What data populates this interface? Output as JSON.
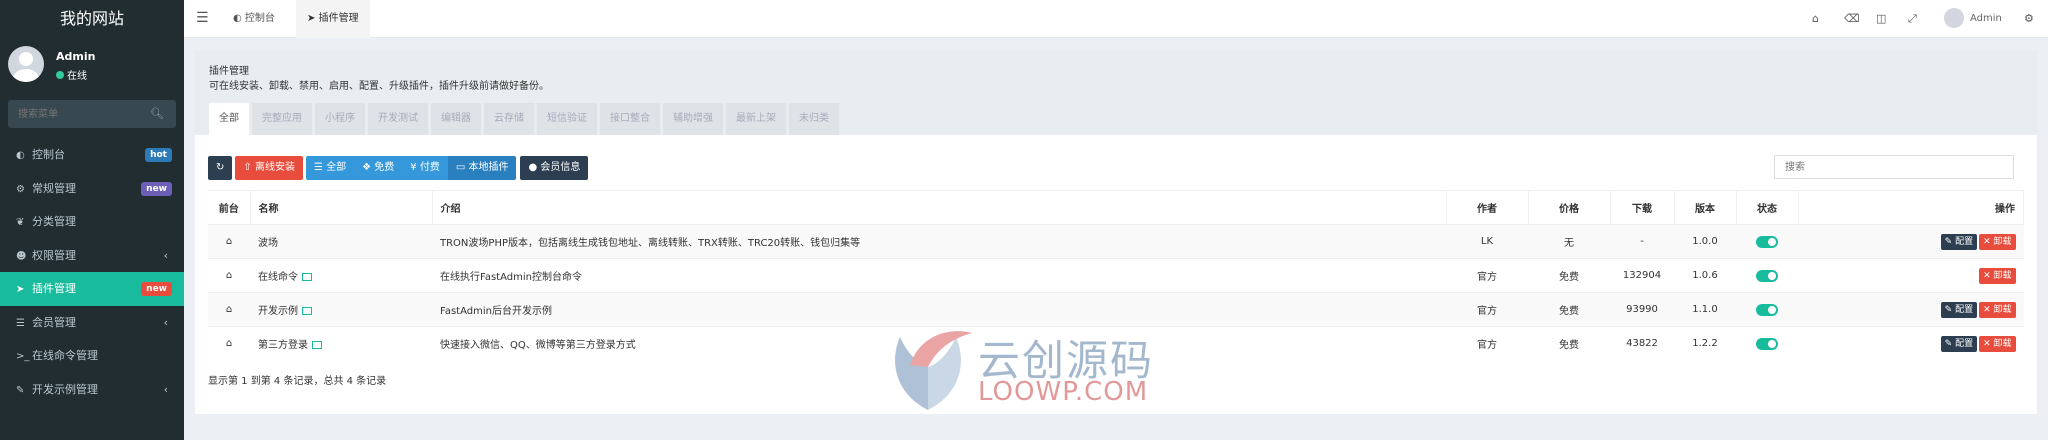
{
  "sidebar": {
    "site_title": "我的网站",
    "user_name": "Admin",
    "user_status": "在线",
    "search_placeholder": "搜索菜单",
    "items": [
      {
        "label": "控制台",
        "icon": "dashboard-icon",
        "badge": "hot",
        "badge_color": "#2c7ab8"
      },
      {
        "label": "常规管理",
        "icon": "cogs-icon",
        "badge": "new",
        "badge_color": "#6d5fb8"
      },
      {
        "label": "分类管理",
        "icon": "leaf-icon"
      },
      {
        "label": "权限管理",
        "icon": "users-icon",
        "chevron": "‹"
      },
      {
        "label": "插件管理",
        "icon": "rocket-icon",
        "badge": "new",
        "badge_color": "#e74c3c"
      },
      {
        "label": "会员管理",
        "icon": "list-icon",
        "chevron": "‹"
      },
      {
        "label": "在线命令管理",
        "icon": "terminal-icon"
      },
      {
        "label": "开发示例管理",
        "icon": "magic-icon",
        "chevron": "‹"
      }
    ]
  },
  "topbar": {
    "tabs": [
      {
        "label": "控制台"
      },
      {
        "label": "插件管理"
      }
    ],
    "user_name": "Admin"
  },
  "panel": {
    "title": "插件管理",
    "description": "可在线安装、卸载、禁用、启用、配置、升级插件，插件升级前请做好备份。",
    "tabs": [
      "全部",
      "完整应用",
      "小程序",
      "开发测试",
      "编辑器",
      "云存储",
      "短信验证",
      "接口整合",
      "辅助增强",
      "最新上架",
      "未归类"
    ]
  },
  "toolbar": {
    "offline_install": "离线安装",
    "filter_all": "全部",
    "filter_free": "免费",
    "filter_paid": "付费",
    "filter_local": "本地插件",
    "member_info": "会员信息",
    "search_placeholder": "搜索"
  },
  "table": {
    "headers": {
      "front": "前台",
      "name": "名称",
      "intro": "介绍",
      "author": "作者",
      "price": "价格",
      "downloads": "下载",
      "version": "版本",
      "status": "状态",
      "action": "操作"
    },
    "rows": [
      {
        "name": "波场",
        "intro": "TRON波场PHP版本，包括离线生成钱包地址、离线转账、TRX转账、TRC20转账、钱包归集等",
        "author": "LK",
        "price": "无",
        "downloads": "-",
        "version": "1.0.0",
        "has_config": true,
        "has_image": false
      },
      {
        "name": "在线命令",
        "intro": "在线执行FastAdmin控制台命令",
        "author": "官方",
        "price": "免费",
        "downloads": "132904",
        "version": "1.0.6",
        "has_config": false,
        "has_image": true
      },
      {
        "name": "开发示例",
        "intro": "FastAdmin后台开发示例",
        "author": "官方",
        "price": "免费",
        "downloads": "93990",
        "version": "1.1.0",
        "has_config": true,
        "has_image": true
      },
      {
        "name": "第三方登录",
        "intro": "快速接入微信、QQ、微博等第三方登录方式",
        "author": "官方",
        "price": "免费",
        "downloads": "43822",
        "version": "1.2.2",
        "has_config": true,
        "has_image": true
      }
    ],
    "config_label": "配置",
    "uninstall_label": "卸载"
  },
  "footer": {
    "records_text": "显示第 1 到第 4 条记录，总共 4 条记录"
  },
  "watermark": {
    "cn": "云创源码",
    "en": "LOOWP.COM"
  },
  "colors": {
    "accent": "#18bc9c",
    "sidebar_bg": "#222d32",
    "danger": "#e74c3c",
    "dark": "#2c3e50",
    "primary": "#3498db"
  }
}
